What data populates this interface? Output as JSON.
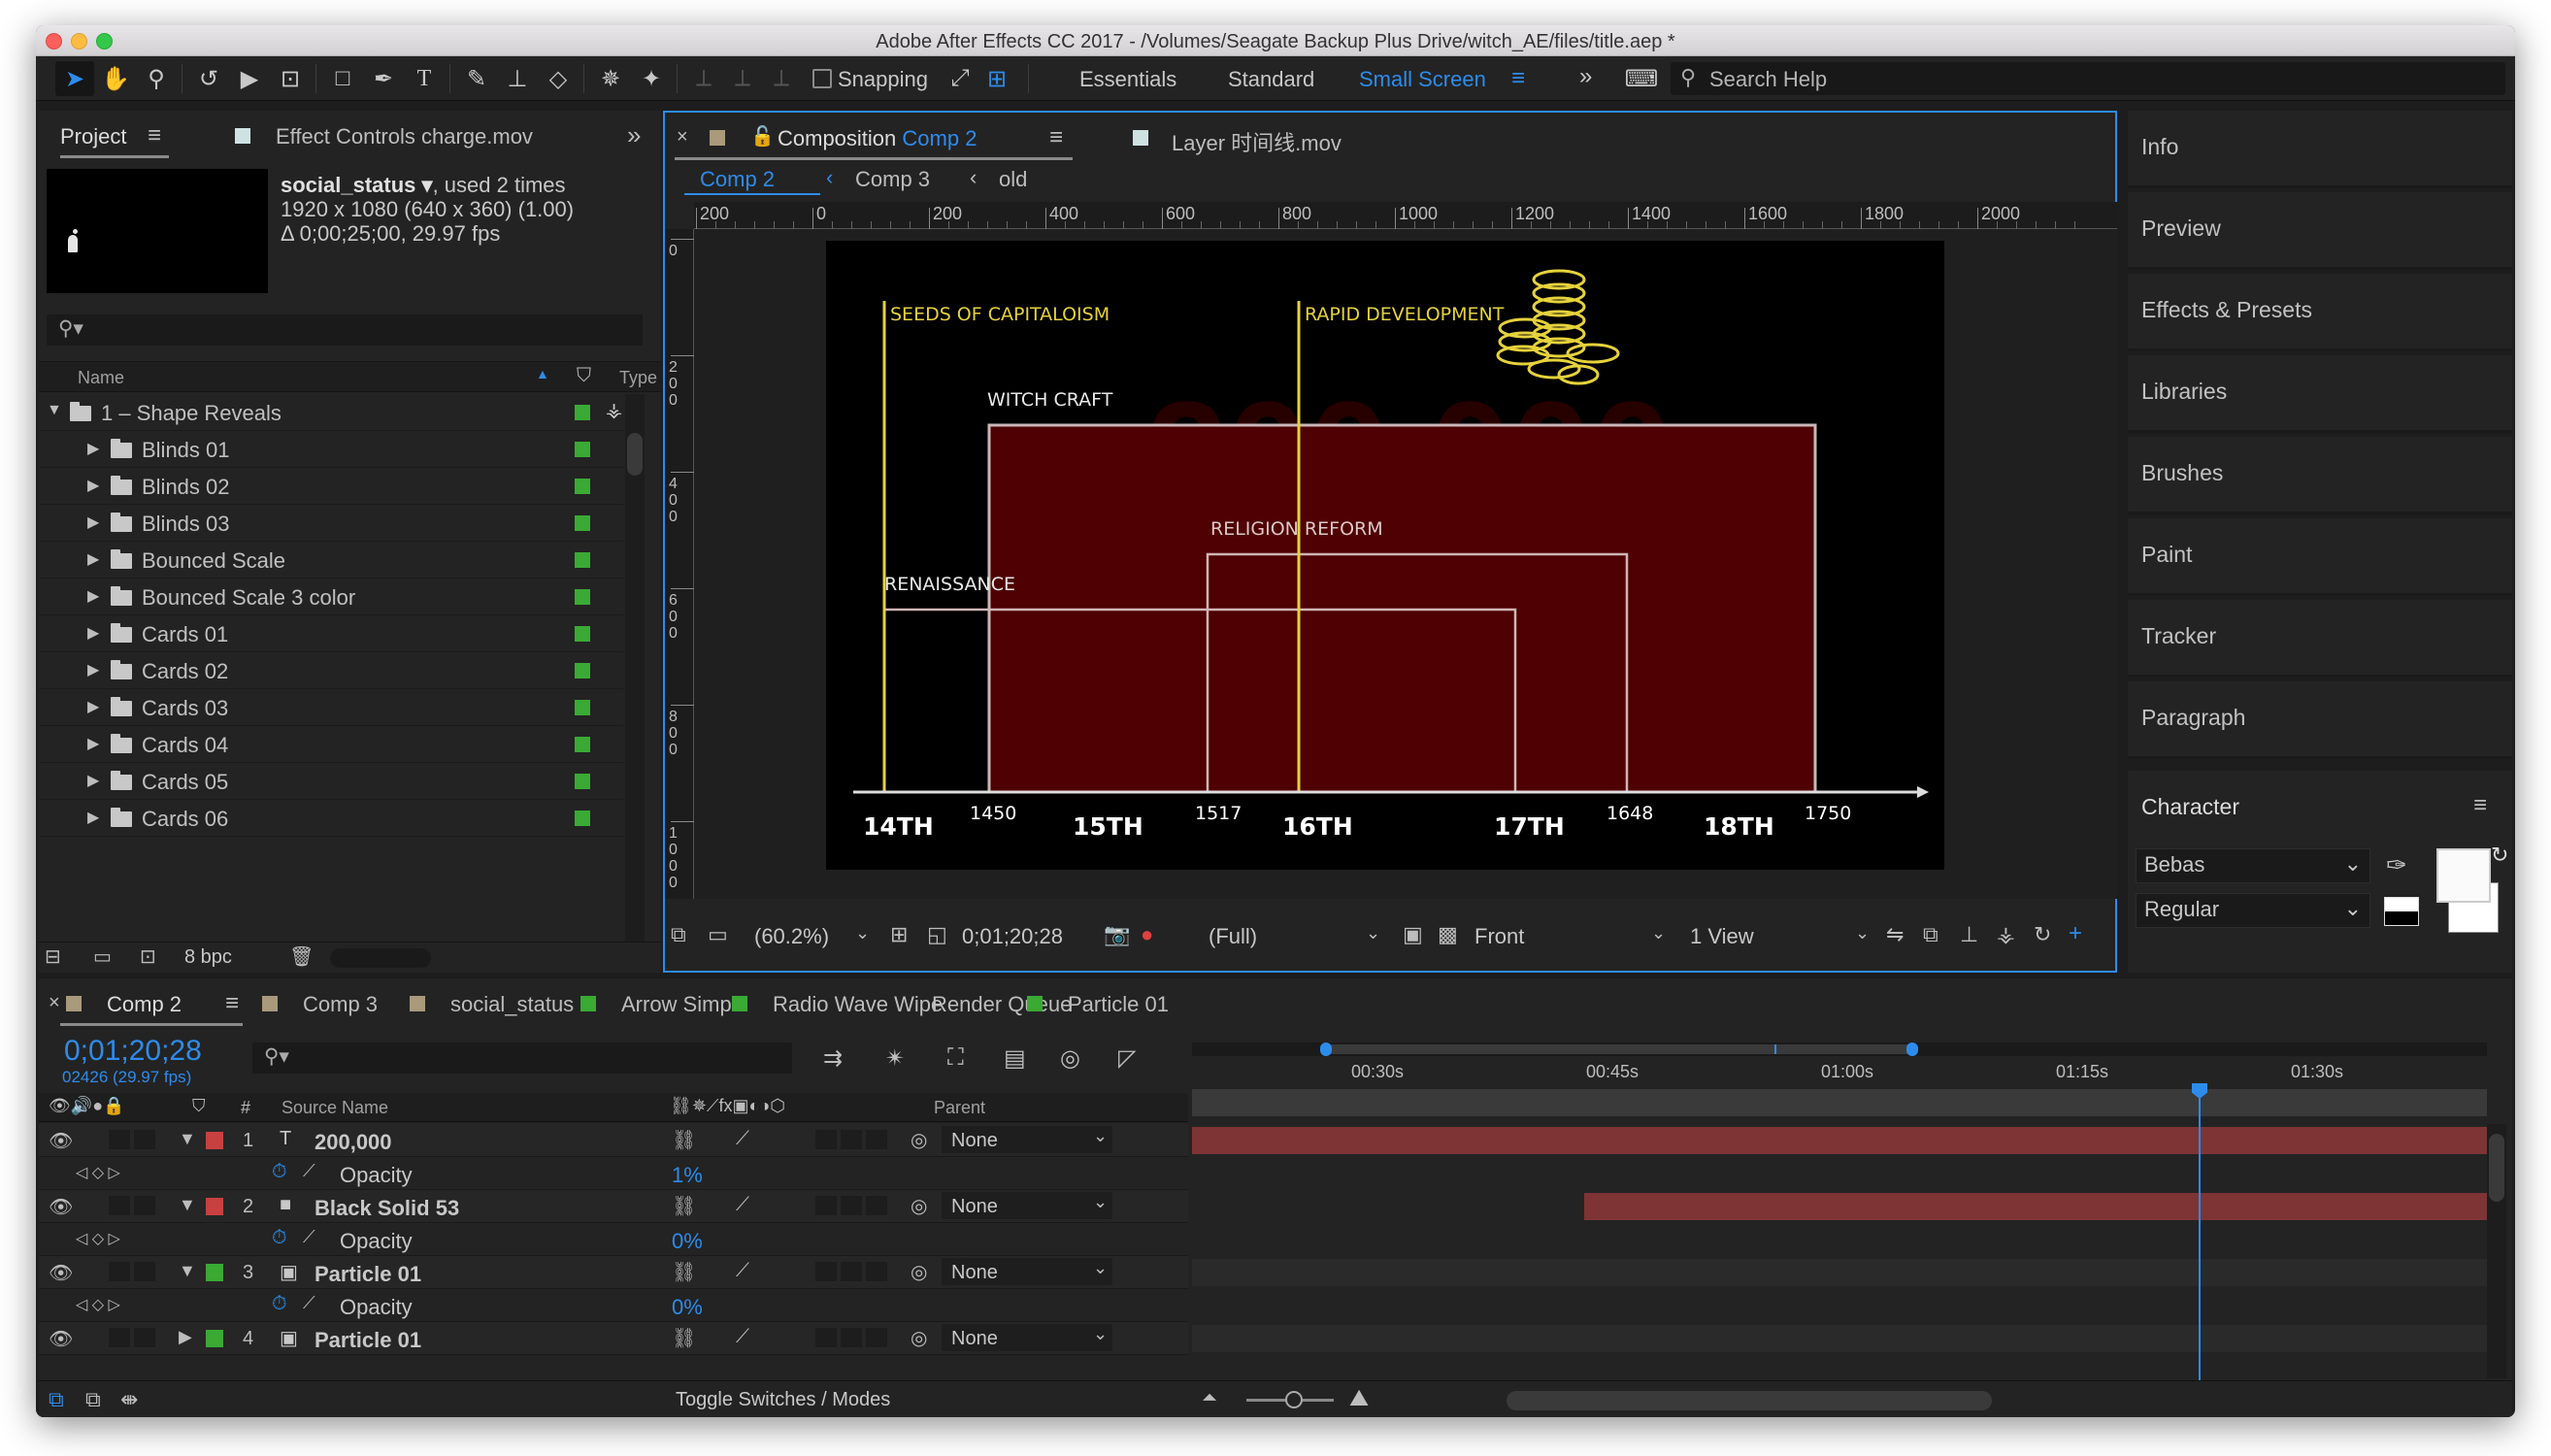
{
  "window": {
    "title": "Adobe After Effects CC 2017 - /Volumes/Seagate Backup Plus Drive/witch_AE/files/title.aep *"
  },
  "toolbar": {
    "snapping": "Snapping",
    "workspaces": [
      "Essentials",
      "Standard",
      "Small Screen"
    ],
    "search_placeholder": "Search Help"
  },
  "project": {
    "tab": "Project",
    "effect_controls_tab": "Effect Controls charge.mov",
    "item_name": "social_status ▾",
    "item_used": ", used 2 times",
    "item_res": "1920 x 1080  (640 x 360) (1.00)",
    "item_duration": "Δ 0;00;25;00, 29.97 fps",
    "col_name": "Name",
    "col_type": "Type",
    "bpc": "8 bpc",
    "items": [
      {
        "label": "1 – Shape Reveals"
      },
      {
        "label": "Blinds 01"
      },
      {
        "label": "Blinds 02"
      },
      {
        "label": "Blinds 03"
      },
      {
        "label": "Bounced Scale"
      },
      {
        "label": "Bounced Scale 3 color"
      },
      {
        "label": "Cards 01"
      },
      {
        "label": "Cards 02"
      },
      {
        "label": "Cards 03"
      },
      {
        "label": "Cards 04"
      },
      {
        "label": "Cards 05"
      },
      {
        "label": "Cards 06"
      }
    ]
  },
  "composition": {
    "tab_prefix": "Composition",
    "tab_name": "Comp 2",
    "layer_tab": "Layer 时间线.mov",
    "breadcrumb": [
      "Comp 2",
      "Comp 3",
      "old"
    ],
    "ruler_h": [
      "200",
      "0",
      "200",
      "400",
      "600",
      "800",
      "1000",
      "1200",
      "1400",
      "1600",
      "1800",
      "2000"
    ],
    "ruler_v": [
      "0",
      "200",
      "400",
      "600",
      "800",
      "1000"
    ],
    "zoom": "(60.2%)",
    "timecode": "0;01;20;28",
    "resolution": "(Full)",
    "view": "Front",
    "views": "1 View",
    "art": {
      "labels": {
        "seeds": "SEEDS OF CAPITALOISM",
        "rapid": "RAPID DEVELOPMENT",
        "witch": "WITCH CRAFT",
        "religion": "RELIGION REFORM",
        "renaissance": "RENAISSANCE"
      },
      "axis": {
        "c14": "14TH",
        "y1450": "1450",
        "c15": "15TH",
        "y1517": "1517",
        "c16": "16TH",
        "c17": "17TH",
        "y1648": "1648",
        "c18": "18TH",
        "y1750": "1750"
      },
      "watermark": "200,000"
    }
  },
  "right_panels": [
    "Info",
    "Preview",
    "Effects & Presets",
    "Libraries",
    "Brushes",
    "Paint",
    "Tracker",
    "Paragraph",
    "Character"
  ],
  "character": {
    "font": "Bebas",
    "style": "Regular"
  },
  "timeline": {
    "tabs": [
      "Comp 2",
      "Comp 3",
      "social_status",
      "Arrow Simple",
      "Radio Wave Wipe",
      "Render Queue",
      "Particle 01"
    ],
    "tab_colors": [
      "#a89a7a",
      "#a89a7a",
      "#a89a7a",
      "#3aaa35",
      "#3aaa35",
      "",
      "#3aaa35"
    ],
    "timecode": "0;01;20;28",
    "frames": "02426 (29.97 fps)",
    "col_source": "Source Name",
    "col_parent": "Parent",
    "ruler": [
      "00:30s",
      "00:45s",
      "01:00s",
      "01:15s",
      "01:30s"
    ],
    "layers": [
      {
        "num": "1",
        "name": "200,000",
        "icon": "T",
        "label_color": "#c94040",
        "parent": "None",
        "prop": "Opacity",
        "prop_value": "1%"
      },
      {
        "num": "2",
        "name": "Black Solid 53",
        "icon": "■",
        "label_color": "#c94040",
        "parent": "None",
        "prop": "Opacity",
        "prop_value": "0%"
      },
      {
        "num": "3",
        "name": "Particle 01",
        "icon": "▣",
        "label_color": "#3aaa35",
        "parent": "None",
        "prop": "Opacity",
        "prop_value": "0%"
      },
      {
        "num": "4",
        "name": "Particle 01",
        "icon": "▣",
        "label_color": "#3aaa35",
        "parent": "None"
      }
    ],
    "toggle": "Toggle Switches / Modes"
  }
}
